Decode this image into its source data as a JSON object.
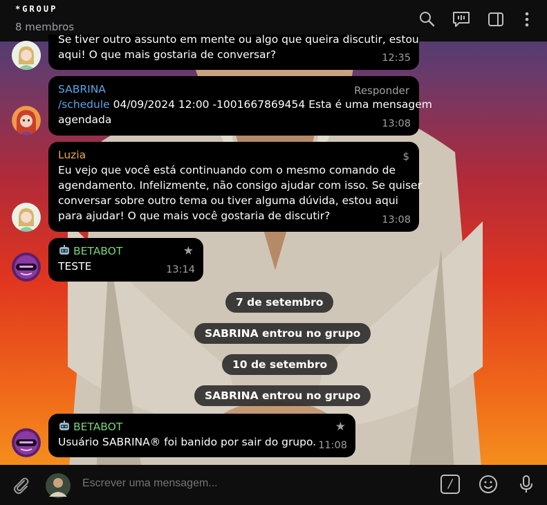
{
  "header": {
    "title": "*GROUP",
    "subtitle": "8 membros"
  },
  "messages": [
    {
      "sender": "",
      "text": "Se tiver outro assunto em mente ou algo que queira discutir, estou aqui! O que mais gostaria de conversar?",
      "line1": "Se tiver outro assunto em mente ou algo que queira discutir, estou",
      "line2": "aqui! O que mais gostaria de conversar?",
      "time": "12:35"
    },
    {
      "sender": "SABRINA",
      "right_label": "Responder",
      "command": "/schedule",
      "text_line1": " 04/09/2024 12:00 -1001667869454 Esta é uma mensagem",
      "text_line2": "agendada",
      "time": "13:08"
    },
    {
      "sender": "Luzia",
      "right_label": "$",
      "line1": "Eu vejo que você está continuando com o mesmo comando de",
      "line2": "agendamento. Infelizmente, não consigo ajudar com isso. Se quiser",
      "line3": "conversar sobre outro tema ou tiver alguma dúvida, estou aqui",
      "line4": "para ajudar! O que mais você gostaria de discutir?",
      "time": "13:08"
    },
    {
      "sender": "BETABOT",
      "right_label": "★",
      "text": "TESTE",
      "time": "13:14"
    },
    {
      "sender": "BETABOT",
      "right_label": "★",
      "text": "Usuário SABRINA® foi banido por sair do grupo.",
      "time": "11:08"
    }
  ],
  "service": {
    "date1": "7 de setembro",
    "joined1": "SABRINA entrou no grupo",
    "date2": "10 de setembro",
    "joined2": "SABRINA entrou no grupo"
  },
  "composer": {
    "placeholder": "Escrever uma mensagem...",
    "commands_label": "/"
  },
  "colors": {
    "sabrina": "#5aa7e6",
    "luzia": "#f0a94a",
    "betabot": "#7bd47b",
    "link": "#5aa7e6"
  },
  "icons": [
    "search-icon",
    "video-chat-icon",
    "sidebar-toggle-icon",
    "more-vertical-icon",
    "attach-icon",
    "commands-icon",
    "emoji-icon",
    "microphone-icon",
    "robot-icon"
  ]
}
